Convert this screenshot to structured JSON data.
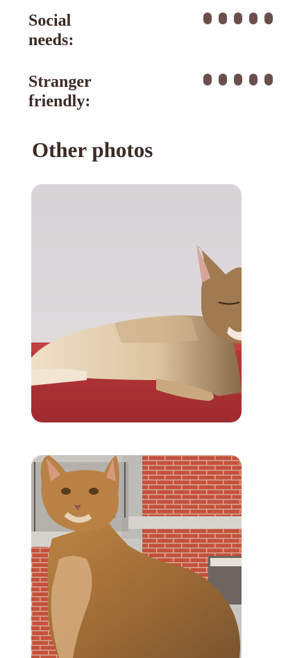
{
  "traits": [
    {
      "label_line1": "Social",
      "label_line2": "needs:",
      "dots": 5
    },
    {
      "label_line1": "Stranger",
      "label_line2": "friendly:",
      "dots": 5
    }
  ],
  "colors": {
    "text": "#3b2a25",
    "dot": "#6b4f4c"
  },
  "section": {
    "title": "Other photos"
  },
  "photos": [
    {
      "icon": "cat-lying-on-red-cushion-photo"
    },
    {
      "icon": "cat-sitting-in-front-of-brick-building-photo"
    }
  ]
}
